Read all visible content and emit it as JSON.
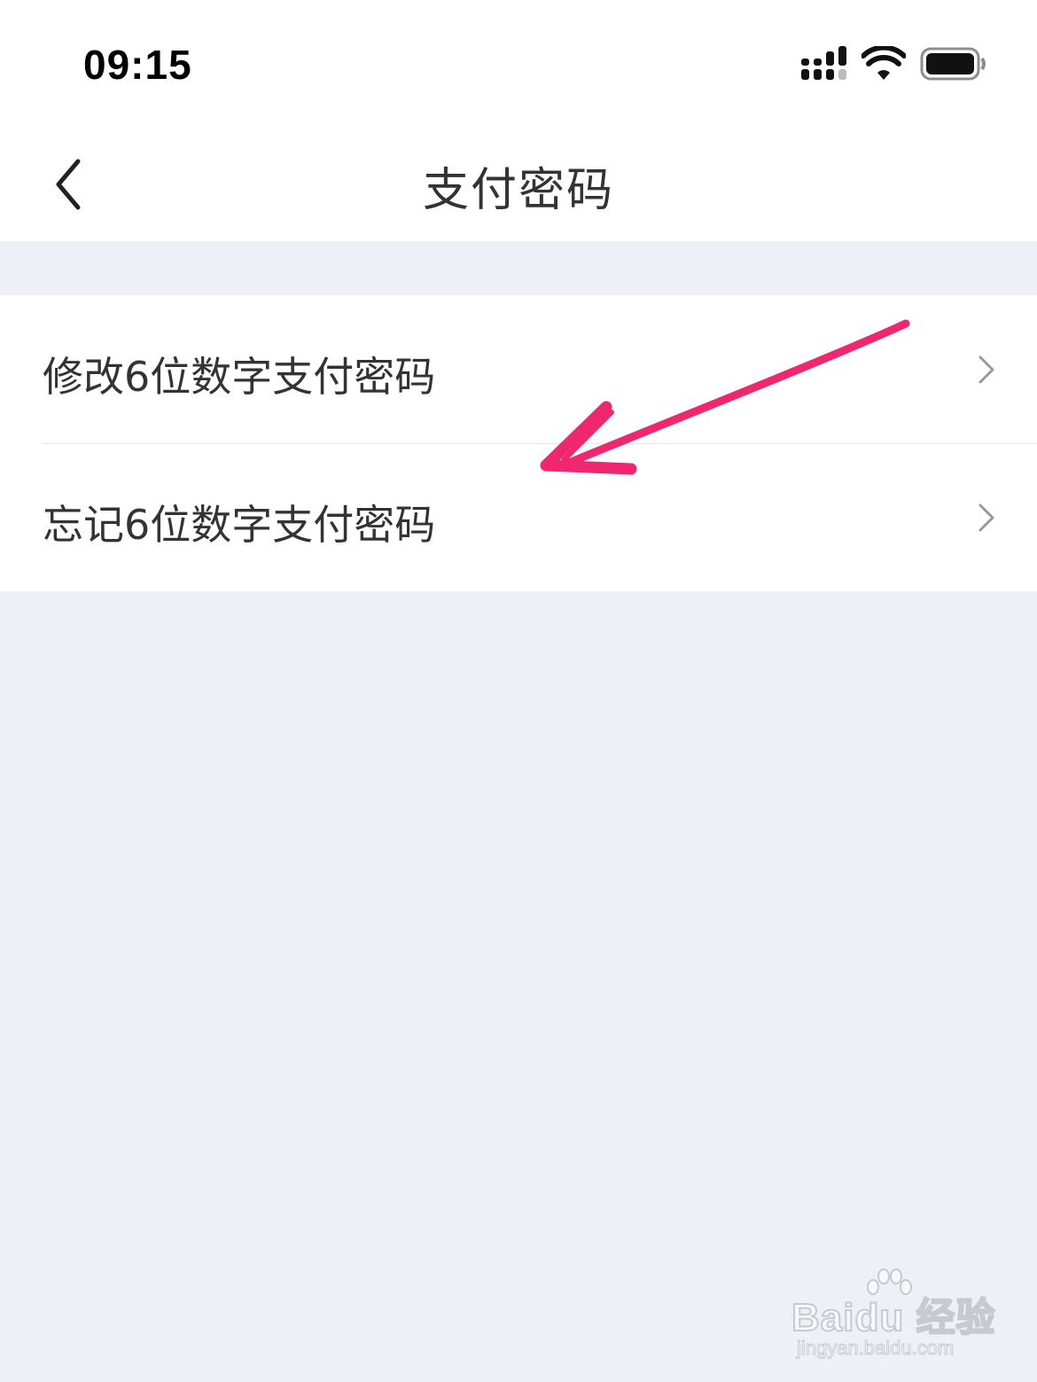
{
  "status_bar": {
    "time": "09:15"
  },
  "nav": {
    "title": "支付密码"
  },
  "menu": {
    "items": [
      {
        "label": "修改6位数字支付密码"
      },
      {
        "label": "忘记6位数字支付密码"
      }
    ]
  },
  "annotation": {
    "color": "#F0266F"
  },
  "watermark": {
    "brand": "Baidu 经验",
    "url": "jingyan.baidu.com"
  },
  "colors": {
    "background": "#EFF0F5",
    "surface": "#FFFFFF",
    "text": "#333333",
    "chevron": "#999999",
    "divider": "#E6E6E6"
  }
}
